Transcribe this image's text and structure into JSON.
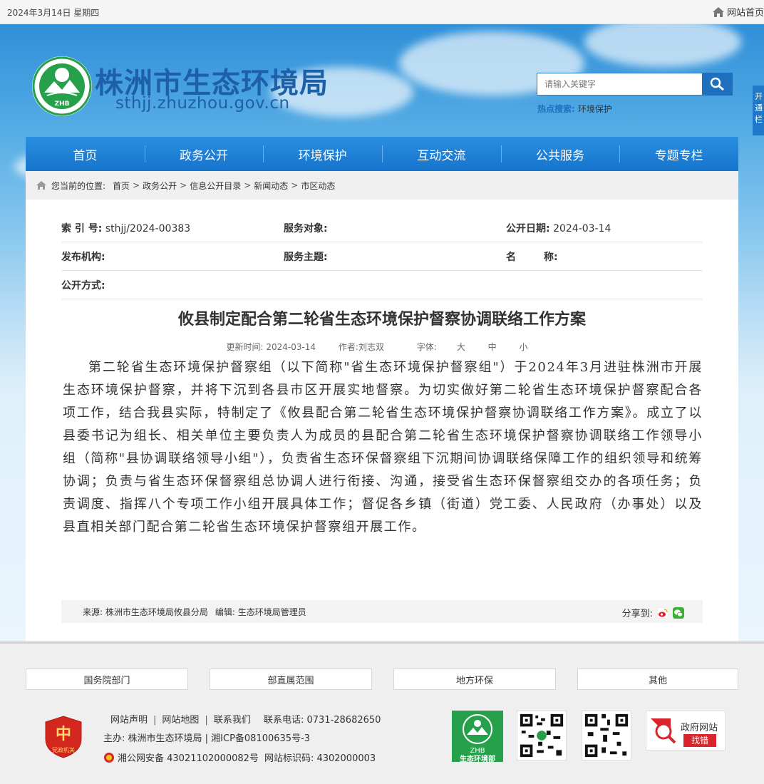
{
  "topbar": {
    "date": "2024年3月14日 星期四",
    "home_link": "网站首页"
  },
  "header": {
    "site_title": "株洲市生态环境局",
    "site_domain": "sthjj.zhuzhou.gov.cn",
    "logo_text": "ZHB",
    "search": {
      "placeholder": "请输入关键字"
    },
    "hot_search": {
      "label": "热点搜索:",
      "keyword": "环境保护"
    },
    "side_tab": "开通栏"
  },
  "nav": {
    "items": [
      "首页",
      "政务公开",
      "环境保护",
      "互动交流",
      "公共服务",
      "专题专栏"
    ]
  },
  "breadcrumb": {
    "label": "您当前的位置:",
    "items": [
      "首页",
      "政务公开",
      "信息公开目录",
      "新闻动态",
      "市区动态"
    ]
  },
  "meta": {
    "index_label": "索  引  号:",
    "index_value": "sthjj/2024-00383",
    "target_label": "服务对象:",
    "target_value": "",
    "date_label": "公开日期:",
    "date_value": "2024-03-14",
    "publisher_label": "发布机构:",
    "publisher_value": "",
    "topic_label": "服务主题:",
    "topic_value": "",
    "name_label": "名        称:",
    "name_value": "",
    "method_label": "公开方式:",
    "method_value": ""
  },
  "article": {
    "title": "攸县制定配合第二轮省生态环境保护督察协调联络工作方案",
    "updated": "更新时间:  2024-03-14",
    "author": "作者:刘志双",
    "font_label": "字体:",
    "font_sizes": [
      "大",
      "中",
      "小"
    ],
    "body": "第二轮省生态环境保护督察组（以下简称\"省生态环境保护督察组\"）于2024年3月进驻株洲市开展生态环境保护督察，并将下沉到各县市区开展实地督察。为切实做好第二轮省生态环境保护督察配合各项工作，结合我县实际，特制定了《攸县配合第二轮省生态环境保护督察协调联络工作方案》。成立了以县委书记为组长、相关单位主要负责人为成员的县配合第二轮省生态环境保护督察协调联络工作领导小组（简称\"县协调联络领导小组\"），负责省生态环保督察组下沉期间协调联络保障工作的组织领导和统筹协调；负责与省生态环保督察组总协调人进行衔接、沟通，接受省生态环保督察组交办的各项任务；负责调度、指挥八个专项工作小组开展具体工作；督促各乡镇（街道）党工委、人民政府（办事处）以及县直相关部门配合第二轮省生态环境保护督察组开展工作。",
    "source": "来源:  株洲市生态环境局攸县分局",
    "editor": "编辑:  生态环境局管理员",
    "share_label": "分享到:"
  },
  "footer": {
    "tabs": [
      "国务院部门",
      "部直属范围",
      "地方环保",
      "其他"
    ],
    "links": [
      "网站声明",
      "网站地图",
      "联系我们"
    ],
    "phone": "联系电话:  0731-28682650",
    "host": "主办:  株洲市生态环境局 | 湘ICP备08100635号-3",
    "police": "湘公网安备 43021102000082号",
    "site_id": "网站标识码:  4302000003",
    "party_badge": "党政机关",
    "zhb_label": "生态环境部",
    "zhb_logo": "ZHB",
    "gov_line1": "政府网站",
    "gov_line2": "找错"
  },
  "colors": {
    "brand_blue": "#1f6fbf",
    "nav_blue": "#1674cc",
    "error_red": "#d8262c",
    "zhb_green": "#26a04a"
  }
}
